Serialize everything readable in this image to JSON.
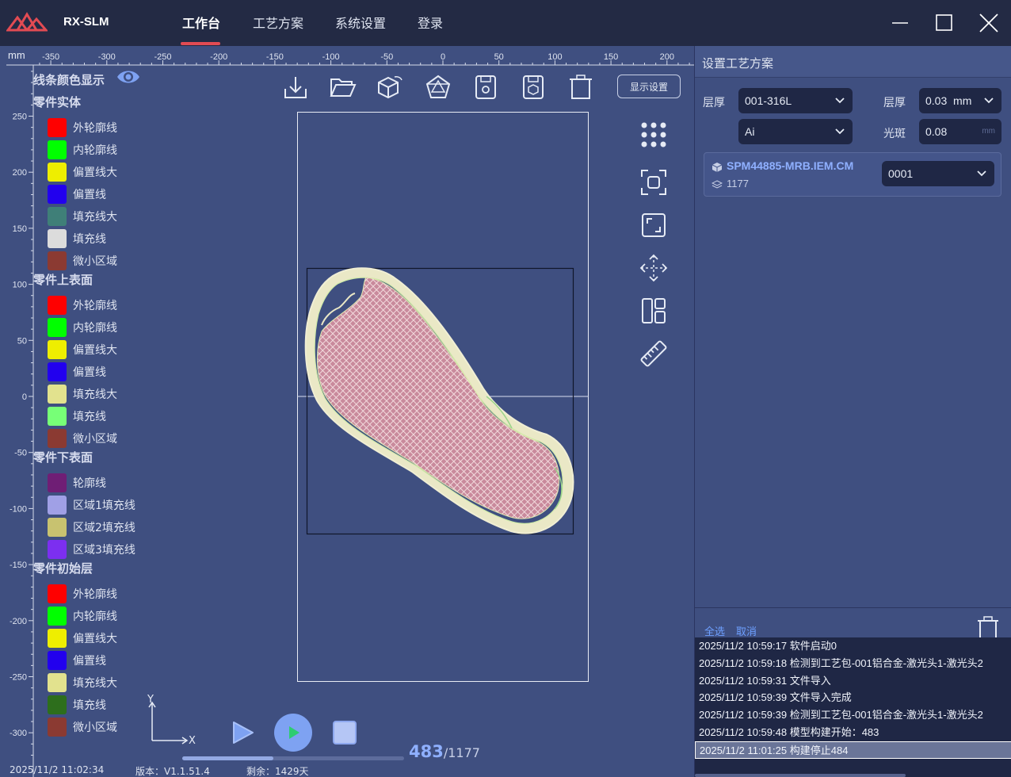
{
  "app": {
    "name": "RX-SLM",
    "nav": [
      {
        "label": "工作台",
        "active": true
      },
      {
        "label": "工艺方案",
        "active": false
      },
      {
        "label": "系统设置",
        "active": false
      },
      {
        "label": "登录",
        "active": false
      }
    ],
    "accent_color": "#e24b53"
  },
  "ruler": {
    "unit": "mm",
    "x_ticks": [
      "-350",
      "-300",
      "-250",
      "-200",
      "-150",
      "-100",
      "-50",
      "0",
      "50",
      "100",
      "150",
      "200"
    ],
    "y_ticks": [
      "250",
      "200",
      "150",
      "100",
      "50",
      "0",
      "-50",
      "-100",
      "-150",
      "-200",
      "-250",
      "-300"
    ]
  },
  "legend": {
    "title": "线条颜色显示",
    "groups": [
      {
        "title": "零件实体",
        "items": [
          {
            "label": "外轮廓线",
            "color": "#ff0000"
          },
          {
            "label": "内轮廓线",
            "color": "#00ff00"
          },
          {
            "label": "偏置线大",
            "color": "#eeee00"
          },
          {
            "label": "偏置线",
            "color": "#2200ee"
          },
          {
            "label": "填充线大",
            "color": "#3f7f78"
          },
          {
            "label": "填充线",
            "color": "#dcdcdc"
          },
          {
            "label": "微小区域",
            "color": "#8b3a32"
          }
        ]
      },
      {
        "title": "零件上表面",
        "items": [
          {
            "label": "外轮廓线",
            "color": "#ff0000"
          },
          {
            "label": "内轮廓线",
            "color": "#00ff00"
          },
          {
            "label": "偏置线大",
            "color": "#eeee00"
          },
          {
            "label": "偏置线",
            "color": "#2200ee"
          },
          {
            "label": "填充线大",
            "color": "#e2e28e"
          },
          {
            "label": "填充线",
            "color": "#77ff77"
          },
          {
            "label": "微小区域",
            "color": "#8b3a32"
          }
        ]
      },
      {
        "title": "零件下表面",
        "items": [
          {
            "label": "轮廓线",
            "color": "#6f1e75"
          },
          {
            "label": "区域1填充线",
            "color": "#a0a0e6"
          },
          {
            "label": "区域2填充线",
            "color": "#c8c270"
          },
          {
            "label": "区域3填充线",
            "color": "#7c2ff0"
          }
        ]
      },
      {
        "title": "零件初始层",
        "items": [
          {
            "label": "外轮廓线",
            "color": "#ff0000"
          },
          {
            "label": "内轮廓线",
            "color": "#00ff00"
          },
          {
            "label": "偏置线大",
            "color": "#eeee00"
          },
          {
            "label": "偏置线",
            "color": "#2200ee"
          },
          {
            "label": "填充线大",
            "color": "#e2e28e"
          },
          {
            "label": "填充线",
            "color": "#2d6e1c"
          },
          {
            "label": "微小区域",
            "color": "#8b3a32"
          }
        ]
      }
    ]
  },
  "toolbar": {
    "icons": [
      "import-icon",
      "open-folder-icon",
      "3d-box-icon",
      "pentagon-icon",
      "save-icon",
      "save-model-icon",
      "trash-icon"
    ],
    "display_settings_label": "显示设置"
  },
  "side_tools": [
    "grid-icon",
    "focus-icon",
    "fit-screen-icon",
    "move-icon",
    "layout-icon",
    "ruler-icon"
  ],
  "playback": {
    "axis_x": "X",
    "axis_y": "Y",
    "current_layer": "483",
    "total_layers": "/1177",
    "progress": 0.41
  },
  "status": {
    "datetime": "2025/11/2 11:02:34",
    "version": "版本：V1.1.51.4",
    "remaining": "剩余：1429天"
  },
  "panel": {
    "title": "设置工艺方案",
    "layer_thickness_label": "层厚",
    "material": "001-316L",
    "thickness_label": "层厚",
    "thickness_value": "0.03",
    "thickness_unit": "mm",
    "mode": "Ai",
    "spot_label": "光斑",
    "spot_value": "0.08",
    "spot_unit": "mm",
    "part": {
      "name": "SPM44885-MRB.IEM.CM",
      "layers": "1177",
      "selection": "0001"
    },
    "select_all": "全选",
    "cancel": "取消",
    "logs": [
      "2025/11/2 10:59:17 软件启动0",
      "2025/11/2 10:59:18 检测到工艺包-001铝合金-激光头1-激光头2",
      "2025/11/2 10:59:31 文件导入",
      "2025/11/2 10:59:39 文件导入完成",
      "2025/11/2 10:59:39 检测到工艺包-001铝合金-激光头1-激光头2",
      "2025/11/2 10:59:48 模型构建开始：483",
      "2025/11/2 11:01:25 构建停止484"
    ],
    "selected_log": 6
  }
}
